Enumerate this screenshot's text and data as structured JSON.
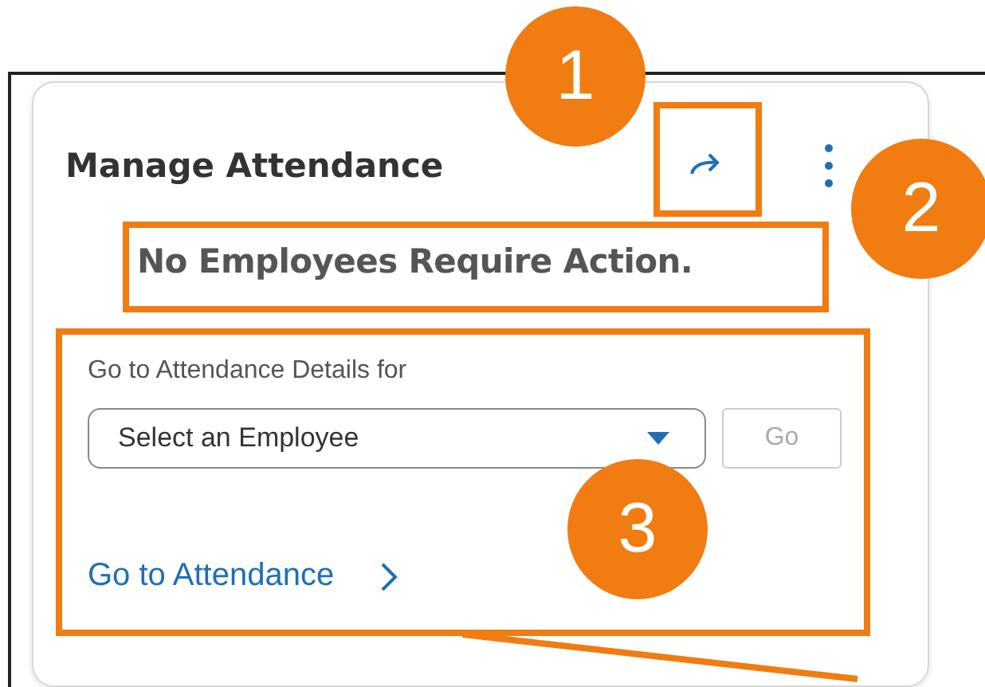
{
  "card": {
    "title": "Manage Attendance",
    "status": "No Employees Require Action.",
    "details_label": "Go to Attendance Details for",
    "employee_select": {
      "value": "Select an Employee"
    },
    "go_button": {
      "label": "Go",
      "disabled": true
    },
    "link": "Go to Attendance"
  },
  "callouts": [
    "1",
    "2",
    "3"
  ]
}
